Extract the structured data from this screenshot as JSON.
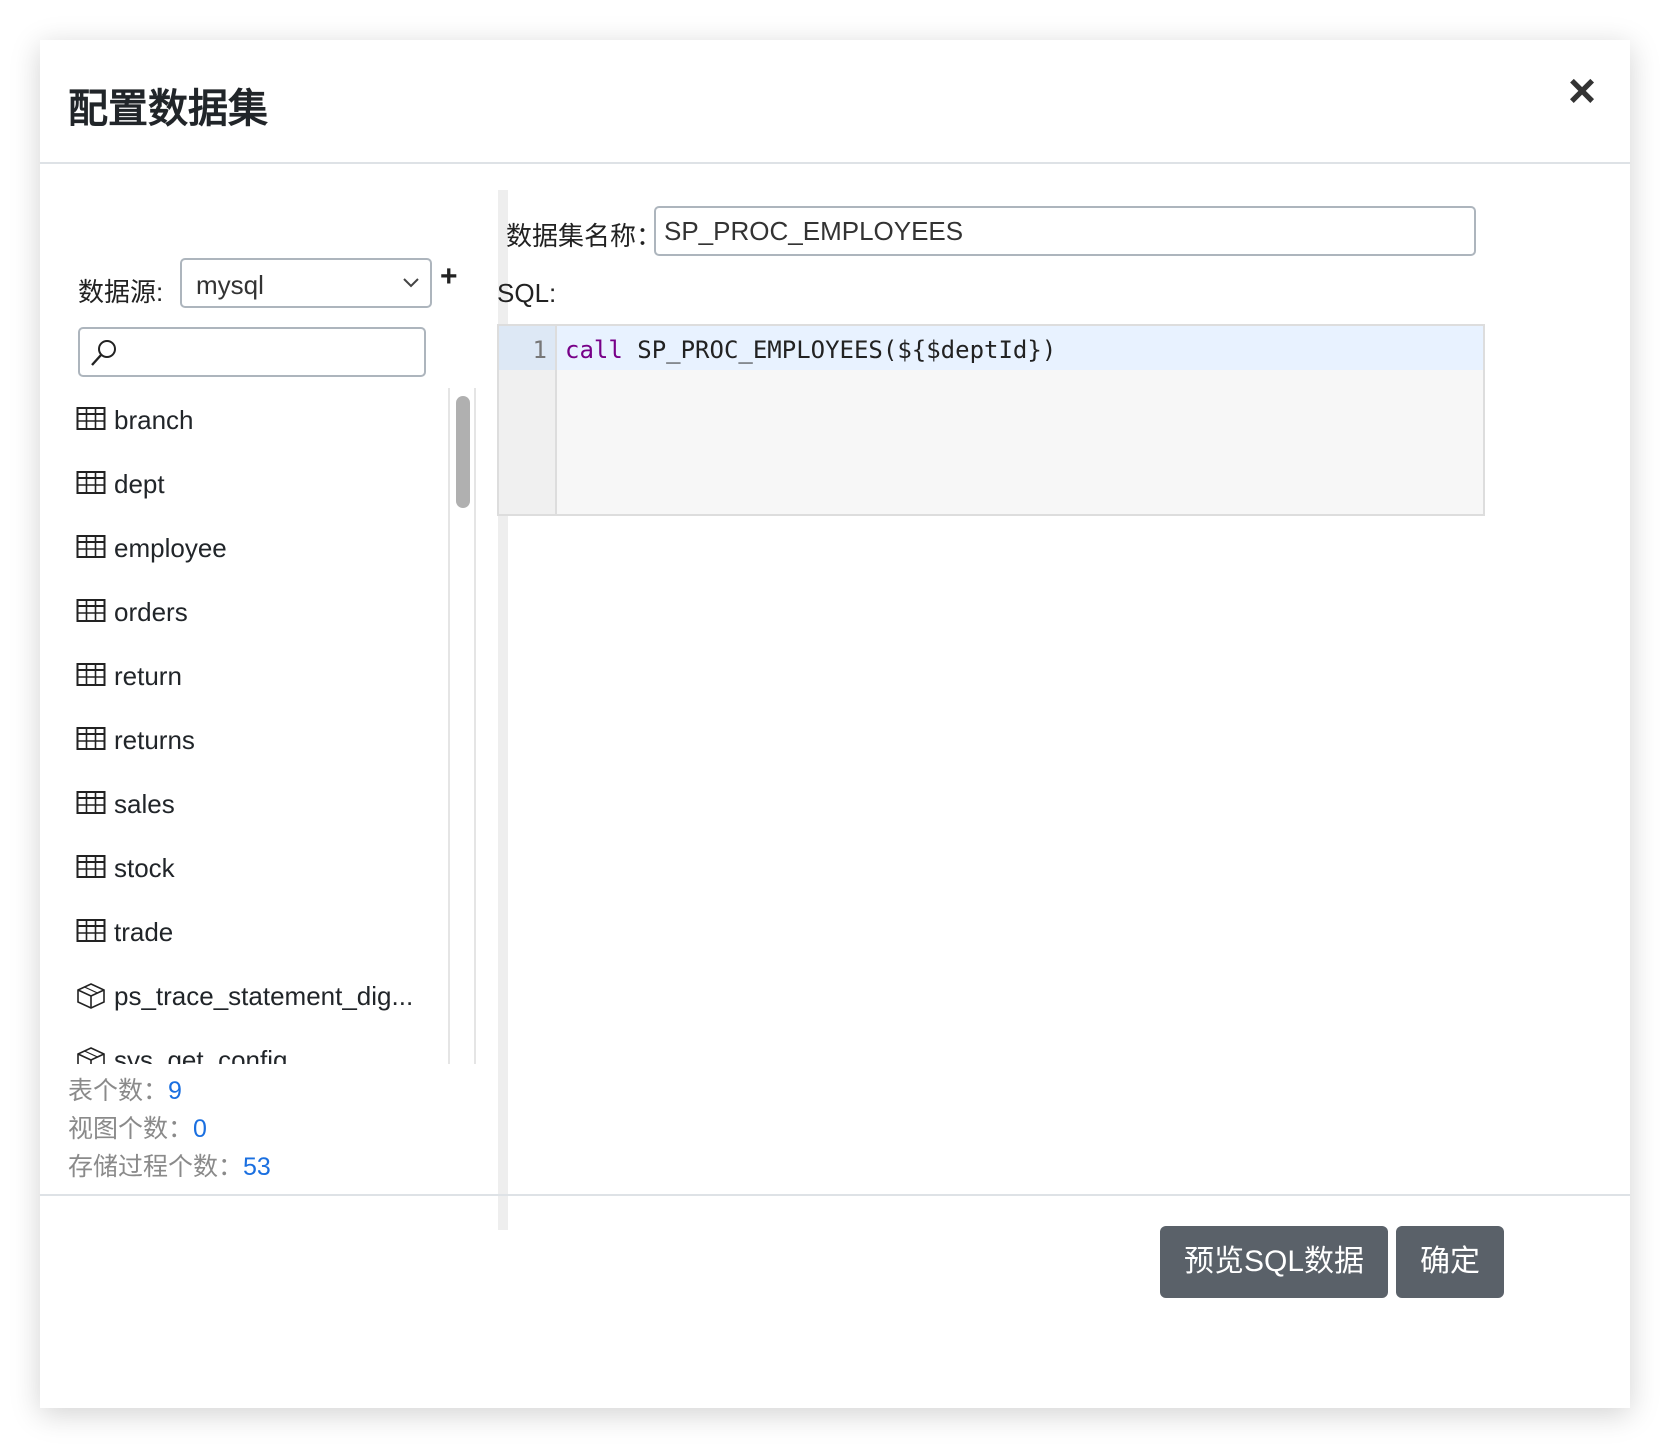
{
  "dialog": {
    "title": "配置数据集",
    "close_icon": "close-icon"
  },
  "datasource": {
    "label": "数据源:",
    "selected": "mysql",
    "add_label": "+"
  },
  "search": {
    "value": "",
    "placeholder": "",
    "icon": "search-icon"
  },
  "tables": [
    {
      "name": "branch",
      "type": "table"
    },
    {
      "name": "dept",
      "type": "table"
    },
    {
      "name": "employee",
      "type": "table"
    },
    {
      "name": "orders",
      "type": "table"
    },
    {
      "name": "return",
      "type": "table"
    },
    {
      "name": "returns",
      "type": "table"
    },
    {
      "name": "sales",
      "type": "table"
    },
    {
      "name": "stock",
      "type": "table"
    },
    {
      "name": "trade",
      "type": "table"
    },
    {
      "name": "ps_trace_statement_dig...",
      "type": "procedure"
    },
    {
      "name": "sys_get_config",
      "type": "procedure"
    }
  ],
  "stats": {
    "table_count_label": "表个数：",
    "table_count": "9",
    "view_count_label": "视图个数：",
    "view_count": "0",
    "proc_count_label": "存储过程个数：",
    "proc_count": "53"
  },
  "dataset": {
    "name_label": "数据集名称：",
    "name_value": "SP_PROC_EMPLOYEES",
    "sql_label": "SQL:"
  },
  "editor": {
    "line_number": "1",
    "keyword": "call",
    "code_rest": " SP_PROC_EMPLOYEES(${$deptId})",
    "keyword_color": "#770088"
  },
  "footer": {
    "preview_label": "预览SQL数据",
    "ok_label": "确定"
  }
}
